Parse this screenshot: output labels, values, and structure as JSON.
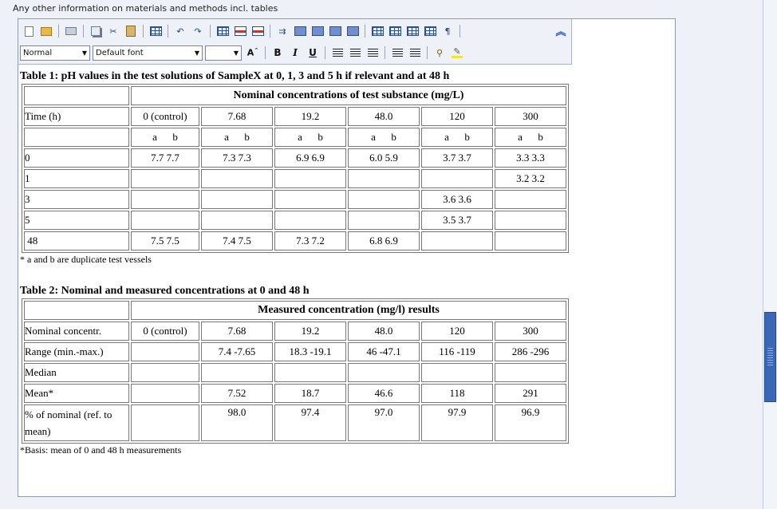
{
  "section_label": "Any other information on materials and methods incl. tables",
  "toolbar": {
    "paragraph_style": "Normal",
    "font_family": "Default font",
    "font_size": "",
    "bold": "B",
    "italic": "I",
    "underline": "U",
    "pilcrow": "¶"
  },
  "table1": {
    "caption": "Table 1: pH values in the test solutions of SampleX at 0, 1, 3 and 5 h if relevant and at 48 h",
    "group_header": "Nominal concentrations of test substance (mg/L)",
    "row_header_label": "Time (h)",
    "columns": [
      "0 (control)",
      "7.68",
      "19.2",
      "48.0",
      "120",
      "300"
    ],
    "subheader": "a      b",
    "rows": [
      {
        "time": "0",
        "cells": [
          "7.7 7.7",
          "7.3 7.3",
          "6.9 6.9",
          "6.0 5.9",
          "3.7 3.7",
          "3.3 3.3"
        ]
      },
      {
        "time": "1",
        "cells": [
          "",
          "",
          "",
          "",
          "",
          "3.2 3.2"
        ]
      },
      {
        "time": "3",
        "cells": [
          "",
          "",
          "",
          "",
          "3.6 3.6",
          ""
        ]
      },
      {
        "time": "5",
        "cells": [
          "",
          "",
          "",
          "",
          "3.5 3.7",
          ""
        ]
      },
      {
        "time": " 48",
        "cells": [
          "7.5 7.5",
          "7.4 7.5",
          "7.3 7.2",
          "6.8 6.9",
          "",
          ""
        ]
      }
    ],
    "footnote": "* a and b are duplicate test vessels"
  },
  "table2": {
    "caption": "Table 2: Nominal and measured concentrations at 0 and 48 h",
    "group_header": "Measured concentration (mg/l) results",
    "rows": [
      {
        "label": "Nominal concentr.",
        "cells": [
          "0 (control)",
          "7.68",
          "19.2",
          "48.0",
          "120",
          "300"
        ]
      },
      {
        "label": "Range (min.-max.)",
        "cells": [
          "",
          "7.4 -7.65",
          "18.3 -19.1",
          "46 -47.1",
          "116 -119",
          "286 -296"
        ]
      },
      {
        "label": "Median",
        "cells": [
          "",
          "",
          "",
          "",
          "",
          ""
        ]
      },
      {
        "label": "Mean*",
        "cells": [
          "",
          "7.52",
          "18.7",
          "46.6",
          "118",
          "291"
        ]
      },
      {
        "label": "% of nominal (ref. to mean)",
        "cells": [
          "",
          "98.0",
          "97.4",
          "97.0",
          "97.9",
          "96.9"
        ]
      }
    ],
    "footnote": "*Basis: mean of 0 and 48 h measurements"
  }
}
